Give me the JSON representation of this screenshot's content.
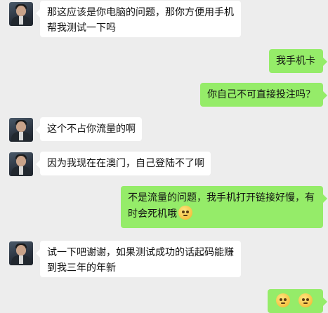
{
  "chat": {
    "messages": [
      {
        "side": "left",
        "lines": [
          "那这应该是你电脑的问题，那你方便用手机",
          "帮我测试一下吗"
        ]
      },
      {
        "side": "right",
        "lines": [
          "我手机卡"
        ]
      },
      {
        "side": "right",
        "lines": [
          "你自己不可直接投注吗？"
        ]
      },
      {
        "side": "left",
        "lines": [
          "这个不占你流量的啊"
        ]
      },
      {
        "side": "left",
        "lines": [
          "因为我现在在澳门，自己登陆不了啊"
        ]
      },
      {
        "side": "right",
        "lines": [
          "不是流量的问题，我手机打开链接好慢，有",
          "时会死机哦"
        ],
        "emoji": "sweat-smile-icon"
      },
      {
        "side": "left",
        "lines": [
          "试一下吧谢谢，如果测试成功的话起码能赚",
          "到我三年的年新"
        ]
      },
      {
        "side": "right",
        "lines": [],
        "emoji": "emoji-pair-icon"
      }
    ]
  },
  "colors": {
    "background": "#ededed",
    "bubble_left": "#ffffff",
    "bubble_right": "#95ec69"
  }
}
